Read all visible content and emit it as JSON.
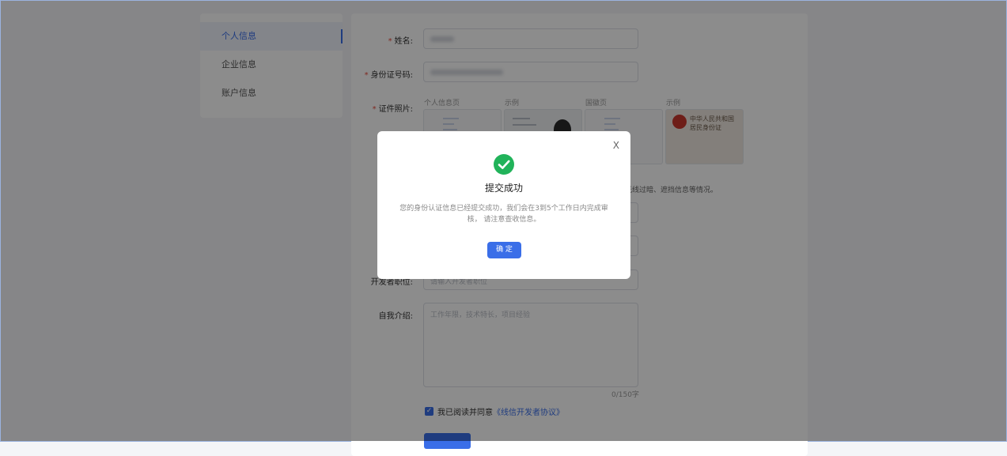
{
  "sidebar": {
    "items": [
      {
        "label": "个人信息",
        "active": true
      },
      {
        "label": "企业信息",
        "active": false
      },
      {
        "label": "账户信息",
        "active": false
      }
    ]
  },
  "form": {
    "name_label": "姓名:",
    "id_label": "身份证号码:",
    "photo_label": "证件照片:",
    "photo_captions": [
      "个人信息页",
      "示例",
      "国徽页",
      "示例"
    ],
    "id_card_sample_text": "中华人民共和国 居民身份证",
    "photo_tip": "光线过暗、遮挡信息等情况。",
    "position_label": "开发者职位:",
    "position_placeholder": "请输入开发者职位",
    "intro_label": "自我介绍:",
    "intro_placeholder": "工作年限，技术特长，项目经验",
    "intro_counter": "0/150字",
    "agree_text": "我已阅读并同意",
    "agree_link": "《线信开发者协议》",
    "required_mark": "*"
  },
  "modal": {
    "title": "提交成功",
    "message": "您的身份认证信息已经提交成功，我们会在3到5个工作日内完成审核， 请注意查收信息。",
    "confirm_label": "确 定",
    "close_label": "X"
  },
  "colors": {
    "accent": "#3a6ee8",
    "success": "#21b35a",
    "required": "#e74c3c"
  }
}
